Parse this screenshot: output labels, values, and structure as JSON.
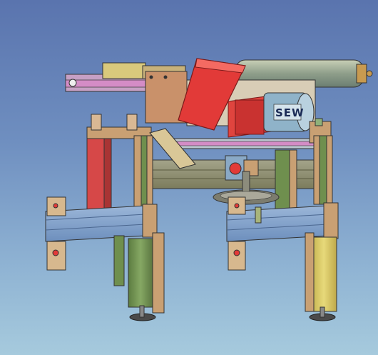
{
  "viewport": {
    "background_top": "#5a74ae",
    "background_bottom": "#a6cadd"
  },
  "model": {
    "motor_brand": "SEW",
    "part_colors": {
      "frame_tan": "#c9a073",
      "profile_blue": "#7f9ec7",
      "profile_olive": "#9a9a6e",
      "leg_green": "#6f8f4e",
      "leg_yellow": "#d7c764",
      "gearbox_red": "#e23a38",
      "cylinder_tan": "#b8bfa6",
      "arm_pink": "#d08ab3",
      "motor_blue": "#8fb3c9"
    }
  }
}
